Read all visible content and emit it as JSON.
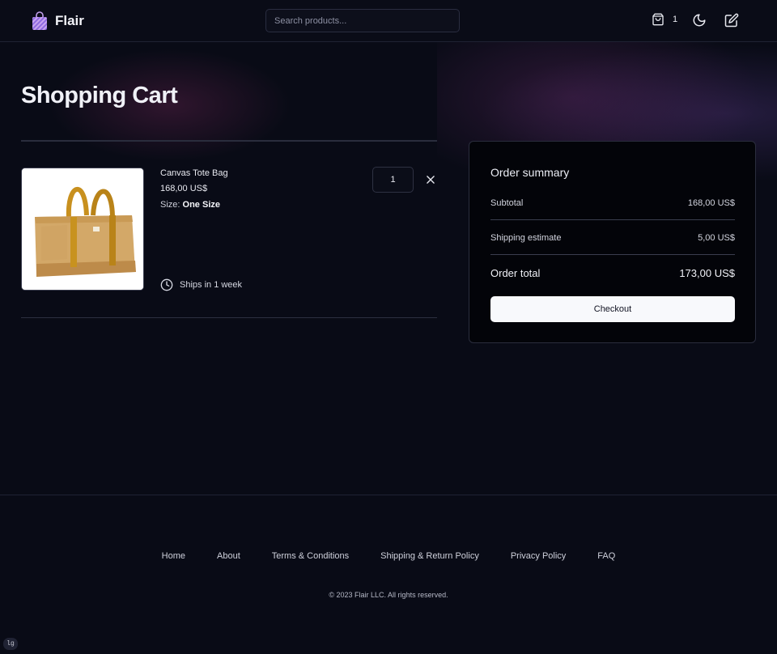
{
  "brand": {
    "name": "Flair"
  },
  "header": {
    "search_placeholder": "Search products...",
    "cart_count": "1"
  },
  "page": {
    "title": "Shopping Cart"
  },
  "cart": {
    "items": [
      {
        "name": "Canvas Tote Bag",
        "price": "168,00 US$",
        "size_label": "Size:",
        "size_value": "One Size",
        "quantity": "1",
        "shipping_note": "Ships in 1 week"
      }
    ]
  },
  "summary": {
    "title": "Order summary",
    "subtotal_label": "Subtotal",
    "subtotal_value": "168,00 US$",
    "shipping_label": "Shipping estimate",
    "shipping_value": "5,00 US$",
    "total_label": "Order total",
    "total_value": "173,00 US$",
    "checkout_label": "Checkout"
  },
  "footer": {
    "links": [
      "Home",
      "About",
      "Terms & Conditions",
      "Shipping & Return Policy",
      "Privacy Policy",
      "FAQ"
    ],
    "copyright": "© 2023 Flair LLC. All rights reserved."
  },
  "breakpoint_badge": "lg",
  "icons": [
    "shopping-bag-logo-icon",
    "cart-icon",
    "moon-icon",
    "edit-icon",
    "close-icon",
    "clock-icon"
  ],
  "colors": {
    "background": "#090b16",
    "panel": "#030409",
    "accent_logo": "#7b5cd6",
    "button": "#f8f9fc"
  }
}
